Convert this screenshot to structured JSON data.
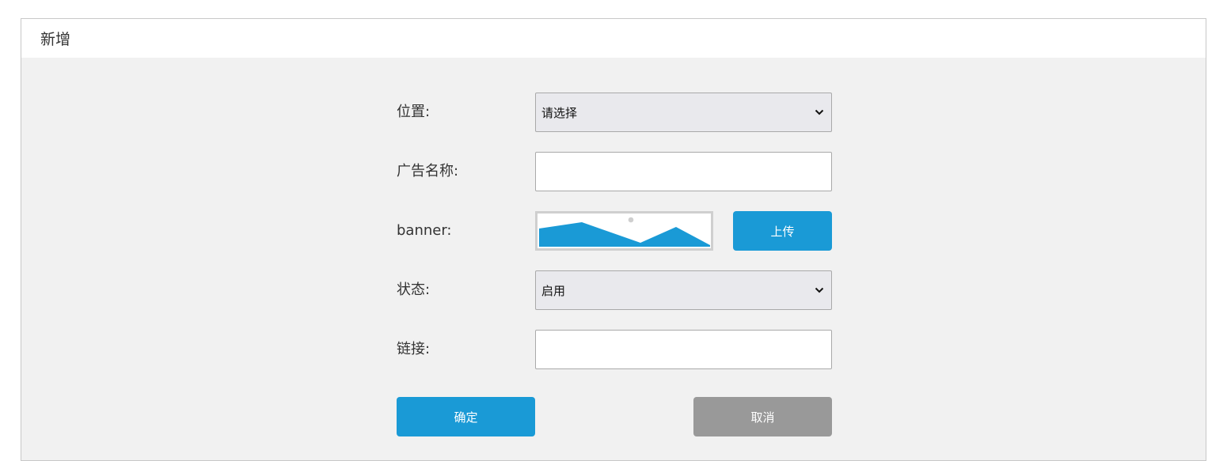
{
  "dialog": {
    "title": "新增"
  },
  "form": {
    "position": {
      "label": "位置:",
      "selected": "请选择"
    },
    "ad_name": {
      "label": "广告名称:",
      "value": ""
    },
    "banner": {
      "label": "banner:",
      "upload_label": "上传",
      "thumbnail_icon": "image-placeholder-icon"
    },
    "status": {
      "label": "状态:",
      "selected": "启用"
    },
    "link": {
      "label": "链接:",
      "value": ""
    }
  },
  "actions": {
    "confirm_label": "确定",
    "cancel_label": "取消"
  },
  "colors": {
    "primary": "#1a9ad6",
    "secondary": "#999999",
    "panel_bg": "#f1f1f1"
  }
}
